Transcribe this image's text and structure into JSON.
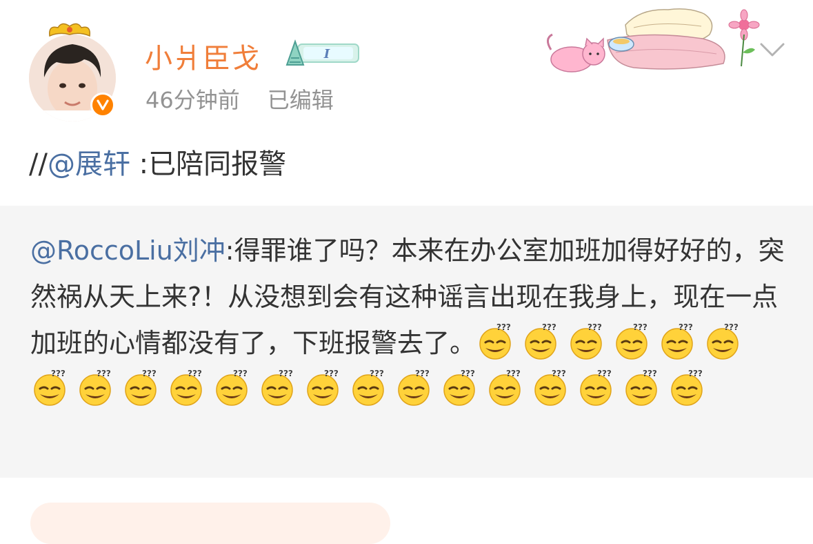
{
  "post": {
    "username": "小爿臣戈",
    "time_ago": "46分钟前",
    "edited_label": "已编辑",
    "repost_prefix": "//",
    "repost_mention": "@展轩",
    "repost_text": " :已陪同报警"
  },
  "quoted": {
    "author_mention": "@RoccoLiu刘冲",
    "text": ":得罪谁了吗？本来在办公室加班加得好好的，突然祸从天上来?！从没想到会有这种谣言出现在我身上，现在一点加班的心情都没有了，下班报警去了。",
    "emoji_count": 21
  },
  "colors": {
    "username": "#f07e3a",
    "mention": "#4a6fa2",
    "meta": "#939393",
    "quoted_bg": "#f5f5f5",
    "verified_badge": "#ff8200"
  },
  "icons": {
    "verified": "v-badge-icon",
    "expand": "chevron-down-icon",
    "emoji": "smirk-emoji-icon"
  }
}
